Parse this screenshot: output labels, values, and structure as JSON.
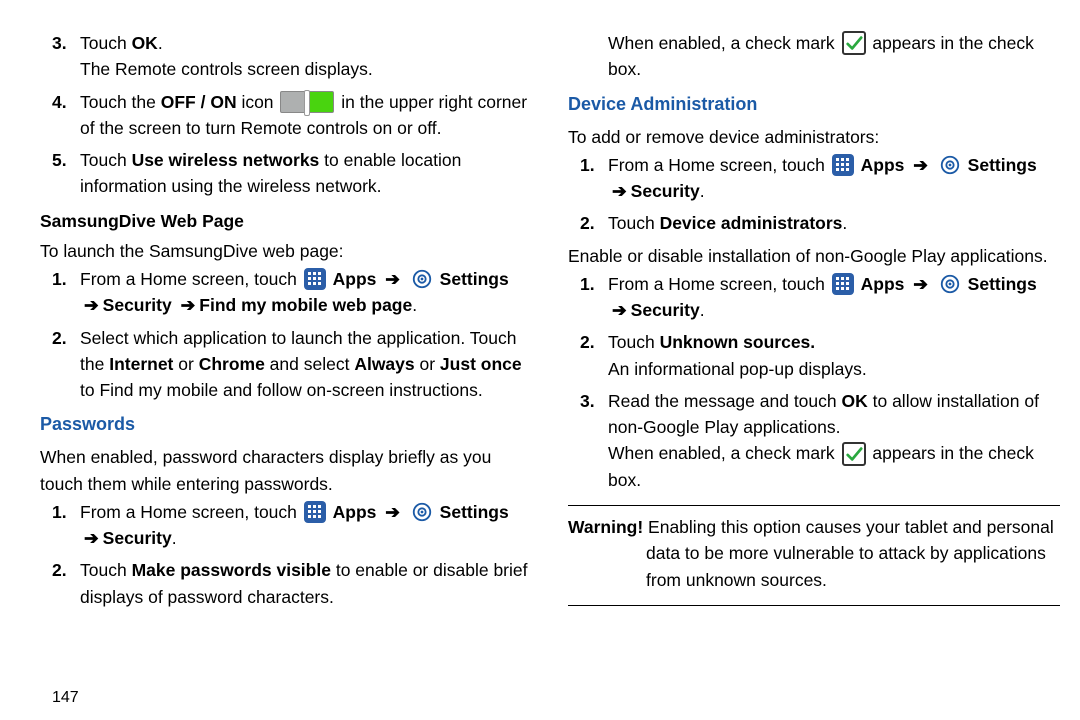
{
  "left": {
    "step3": {
      "pre": "Touch ",
      "bold": "OK",
      "post": ".",
      "line2": "The Remote controls screen displays."
    },
    "step4": {
      "pre": "Touch the ",
      "bold": "OFF / ON",
      "mid": " icon ",
      "post": " in the upper right corner of the screen to turn Remote controls on or off."
    },
    "step5": {
      "pre": "Touch ",
      "bold": "Use wireless networks",
      "post": " to enable location information using the wireless network."
    },
    "samsungdive": {
      "heading": "SamsungDive Web Page",
      "intro": "To launch the SamsungDive web page:",
      "s1_pre": "From a Home screen, touch ",
      "apps": "Apps",
      "settings": "Settings",
      "path": "Security",
      "path2": "Find my mobile web page",
      "s2_pre": "Select which application to launch the application. Touch the ",
      "internet": "Internet",
      "or": " or ",
      "chrome": "Chrome",
      "andsel": "  and select ",
      "always": "Always",
      "or2": " or ",
      "just": "Just once",
      "s2_post": " to Find my mobile and follow on-screen instructions."
    },
    "passwords": {
      "heading": "Passwords",
      "intro": "When enabled, password characters display briefly as you touch them while entering passwords.",
      "s1_pre": "From a Home screen, touch ",
      "apps": "Apps",
      "settings": "Settings",
      "security": "Security",
      "s2_pre": "Touch ",
      "s2_bold": "Make passwords visible",
      "s2_post": " to enable or disable brief displays of password characters."
    },
    "pagenum": "147"
  },
  "right": {
    "cont_pre": "When enabled, a check mark ",
    "cont_post": " appears in the check box.",
    "devadmin": {
      "heading": "Device Administration",
      "intro": "To add or remove device administrators:",
      "s1_pre": "From a Home screen, touch ",
      "apps": "Apps",
      "settings": "Settings",
      "security": "Security",
      "s2_pre": "Touch ",
      "s2_bold": "Device administrators",
      "s2_post": ".",
      "enable_intro": "Enable or disable installation of non-Google Play applications.",
      "e1_pre": "From a Home screen, touch ",
      "e2_pre": "Touch ",
      "e2_bold": "Unknown sources.",
      "e2_line2": "An informational pop-up displays.",
      "e3_pre": "Read the message and touch ",
      "e3_bold": "OK",
      "e3_post": " to allow installation of non-Google Play applications.",
      "e3_line2_pre": "When enabled, a check mark ",
      "e3_line2_post": " appears in the check box."
    },
    "warning": {
      "label": "Warning! ",
      "text": "Enabling this option causes your tablet and personal data to be more vulnerable to attack by applications from unknown sources."
    }
  }
}
